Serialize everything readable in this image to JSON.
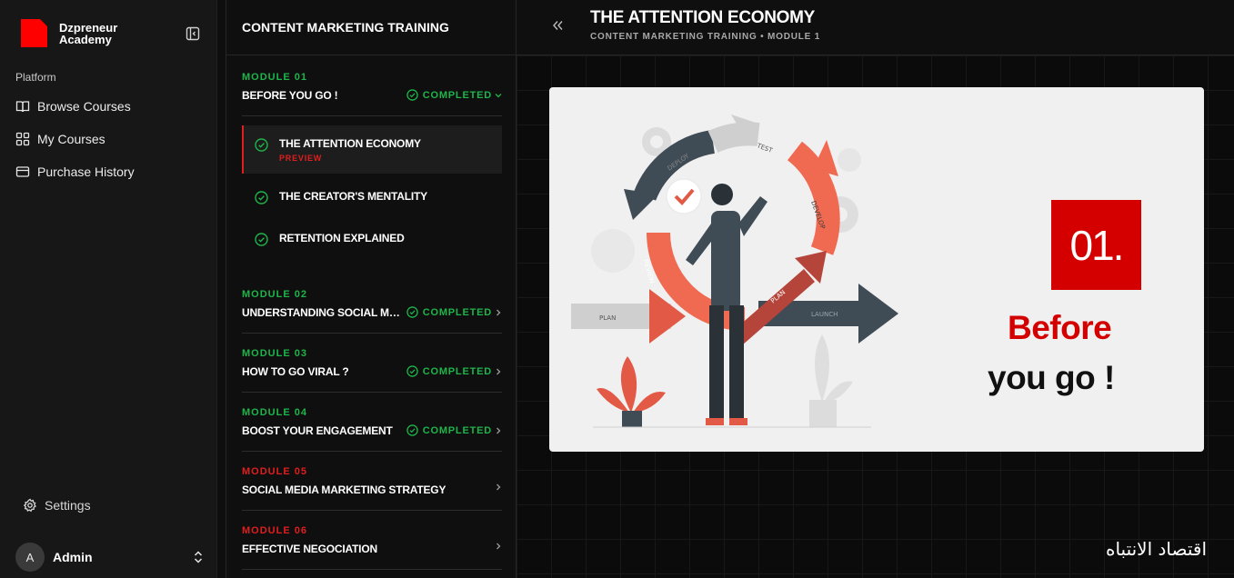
{
  "brand": {
    "name": "Dzpreneur Academy",
    "logo_color": "#ff0000"
  },
  "sidebar": {
    "section_label": "Platform",
    "items": [
      {
        "label": "Browse Courses",
        "icon": "book-open-icon"
      },
      {
        "label": "My Courses",
        "icon": "grid-icon"
      },
      {
        "label": "Purchase History",
        "icon": "credit-card-icon"
      }
    ],
    "settings_label": "Settings",
    "user": {
      "initial": "A",
      "name": "Admin"
    }
  },
  "outline": {
    "course_title": "CONTENT MARKETING TRAINING",
    "modules": [
      {
        "label": "MODULE 01",
        "title": "BEFORE YOU GO !",
        "status": "COMPLETED",
        "state": "done"
      },
      {
        "label": "MODULE 02",
        "title": "UNDERSTANDING SOCIAL MEDIA",
        "status": "COMPLETED",
        "state": "done"
      },
      {
        "label": "MODULE 03",
        "title": "HOW TO GO VIRAL ?",
        "status": "COMPLETED",
        "state": "done"
      },
      {
        "label": "MODULE 04",
        "title": "BOOST YOUR ENGAGEMENT",
        "status": "COMPLETED",
        "state": "done"
      },
      {
        "label": "MODULE 05",
        "title": "SOCIAL MEDIA MARKETING STRATEGY",
        "status": "",
        "state": "locked"
      },
      {
        "label": "MODULE 06",
        "title": "EFFECTIVE NEGOCIATION",
        "status": "",
        "state": "locked"
      }
    ],
    "lessons": [
      {
        "title": "THE ATTENTION ECONOMY",
        "tag": "PREVIEW"
      },
      {
        "title": "THE CREATOR'S MENTALITY",
        "tag": ""
      },
      {
        "title": "RETENTION EXPLAINED",
        "tag": ""
      }
    ]
  },
  "main": {
    "title": "THE ATTENTION ECONOMY",
    "subtitle": "CONTENT MARKETING TRAINING • MODULE 1",
    "slide": {
      "badge": "01.",
      "line1": "Before",
      "line2": "you go !",
      "cycle_labels": {
        "deploy": "DEPLOY",
        "test": "TEST",
        "develop": "DEVELOP",
        "review": "REVIEW",
        "plan": "PLAN",
        "launch": "LAUNCH"
      }
    },
    "caption": "اقتصاد الانتباه"
  },
  "colors": {
    "accent_red": "#d40000",
    "success_green": "#1eb54a"
  }
}
